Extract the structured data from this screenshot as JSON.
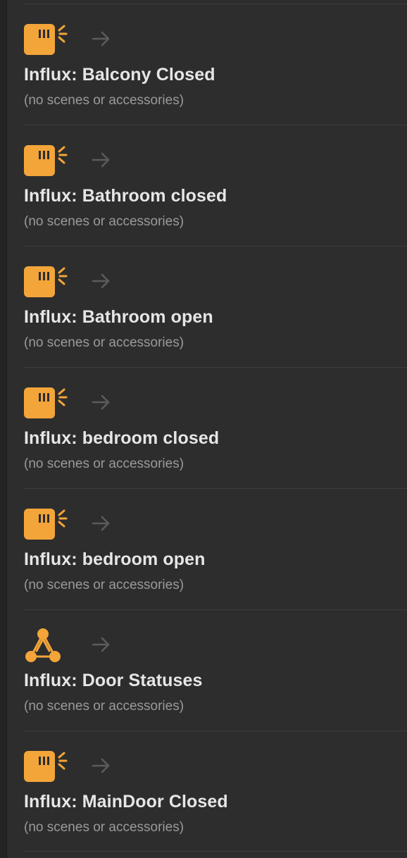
{
  "colors": {
    "accent": "#f3a53a",
    "background": "#2d2d2d",
    "title": "#e6e6e6",
    "subtitle": "#9a9a9a",
    "arrow": "#5c5c5c"
  },
  "automations": [
    {
      "title": "Influx: Balcony Closed",
      "subtitle": "(no scenes or accessories)",
      "icon": "sensor-icon"
    },
    {
      "title": "Influx: Bathroom closed",
      "subtitle": "(no scenes or accessories)",
      "icon": "sensor-icon"
    },
    {
      "title": "Influx: Bathroom open",
      "subtitle": "(no scenes or accessories)",
      "icon": "sensor-icon"
    },
    {
      "title": "Influx: bedroom closed",
      "subtitle": "(no scenes or accessories)",
      "icon": "sensor-icon"
    },
    {
      "title": "Influx: bedroom open",
      "subtitle": "(no scenes or accessories)",
      "icon": "sensor-icon"
    },
    {
      "title": "Influx: Door Statuses",
      "subtitle": "(no scenes or accessories)",
      "icon": "network-icon"
    },
    {
      "title": "Influx: MainDoor Closed",
      "subtitle": "(no scenes or accessories)",
      "icon": "sensor-icon"
    }
  ]
}
